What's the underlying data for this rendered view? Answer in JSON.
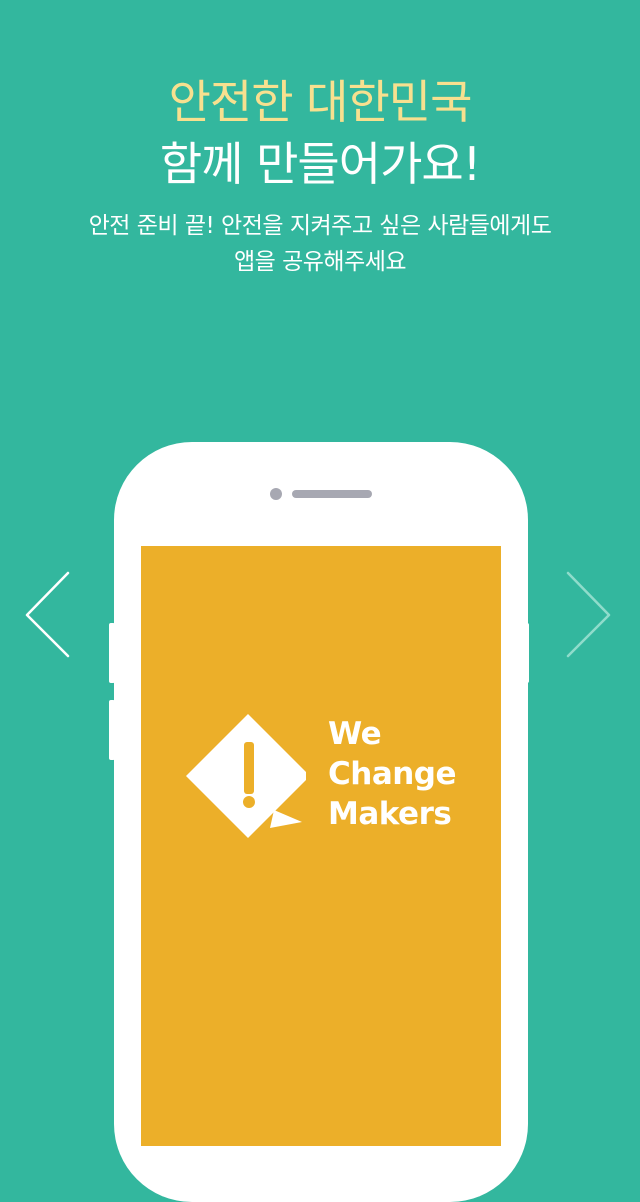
{
  "header": {
    "headline_line1": "안전한 대한민국",
    "headline_line2": "함께 만들어가요!",
    "subtitle_line1": "안전 준비 끝!  안전을 지켜주고 싶은 사람들에게도",
    "subtitle_line2": "앱을 공유해주세요"
  },
  "navigation": {
    "prev_icon": "chevron-left-icon",
    "next_icon": "chevron-right-icon"
  },
  "app_logo": {
    "mark_symbol": "!",
    "line1": "We",
    "line2": "Change",
    "line3": "Makers"
  },
  "colors": {
    "background": "#33b79e",
    "headline_accent": "#f7e08f",
    "screen": "#ecaf29",
    "phone_body": "#ffffff"
  }
}
